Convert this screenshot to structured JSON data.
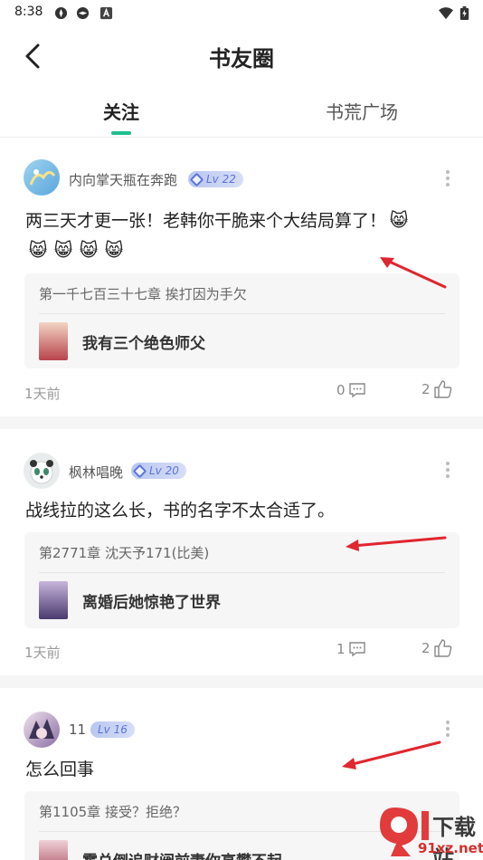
{
  "status_bar": {
    "time": "8:38"
  },
  "header": {
    "title": "书友圈"
  },
  "tabs": [
    {
      "label": "关注",
      "active": true
    },
    {
      "label": "书荒广场",
      "active": false
    }
  ],
  "colors": {
    "accent": "#1fbf8f",
    "annotation_arrow": "#e0262f",
    "level_badge": "#5a74d8"
  },
  "posts": [
    {
      "username": "内向掌天瓶在奔跑",
      "level": "Lv 22",
      "text": "两三天才更一张！老韩你干脆来个大结局算了！",
      "emojis": [
        "😸",
        "😸",
        "😸",
        "😸",
        "😸"
      ],
      "chapter": "第一千七百三十七章 挨打因为手欠",
      "book_title": "我有三个绝色师父",
      "time": "1天前",
      "comments": "0",
      "likes": "2"
    },
    {
      "username": "枫林唱晚",
      "level": "Lv 20",
      "text": "战线拉的这么长，书的名字不太合适了。",
      "chapter": "第2771章 沈天予171(比美)",
      "book_title": "离婚后她惊艳了世界",
      "time": "1天前",
      "comments": "1",
      "likes": "2"
    },
    {
      "username": "11",
      "level": "Lv 16",
      "text": "怎么回事",
      "chapter": "第1105章 接受？拒绝？",
      "book_title": "霍总倒追财阀前妻你高攀不起"
    }
  ],
  "watermark": {
    "text": "下载站",
    "url": "91xz.net"
  }
}
